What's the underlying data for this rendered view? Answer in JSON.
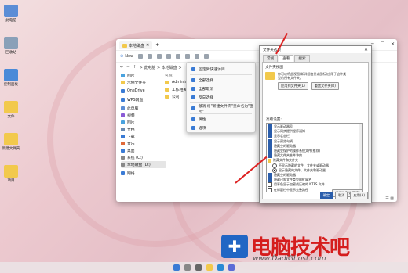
{
  "desktop": {
    "icons": [
      {
        "label": "此电脑",
        "color": "#5b8dd6"
      },
      {
        "label": "回收站",
        "color": "#8aa0b8"
      },
      {
        "label": "控制面板",
        "color": "#4a8ad8"
      },
      {
        "label": "文件",
        "color": "#f2c94c"
      },
      {
        "label": "新建文件夹",
        "color": "#f2c94c"
      },
      {
        "label": "项目",
        "color": "#f2c94c"
      }
    ]
  },
  "explorer": {
    "tab_label": "本地磁盘",
    "new_label": "New",
    "address": "> 此电脑 > 本地磁盘 >",
    "sidebar": [
      {
        "label": "图片",
        "icon": "pictures-icon",
        "color": "#4aa3df"
      },
      {
        "label": "示例文件夹",
        "icon": "folder-icon",
        "color": "#f2c94c"
      },
      {
        "label": "OneDrive",
        "icon": "cloud-icon",
        "color": "#3a7bd5"
      },
      {
        "label": "WPS网盘",
        "icon": "cloud-icon",
        "color": "#3a7bd5"
      },
      {
        "label": "此电脑",
        "icon": "computer-icon",
        "color": "#5b8dd6"
      },
      {
        "label": "视频",
        "icon": "video-icon",
        "color": "#8a5bd6"
      },
      {
        "label": "图片",
        "icon": "pictures-icon",
        "color": "#4aa3df"
      },
      {
        "label": "文档",
        "icon": "document-icon",
        "color": "#6a8ab0"
      },
      {
        "label": "下载",
        "icon": "download-icon",
        "color": "#3a7bd5"
      },
      {
        "label": "音乐",
        "icon": "music-icon",
        "color": "#e06a3a"
      },
      {
        "label": "桌面",
        "icon": "desktop-icon",
        "color": "#3a7bd5"
      },
      {
        "label": "系统 (C:)",
        "icon": "drive-icon",
        "color": "#888888"
      },
      {
        "label": "本地磁盘 (D:)",
        "icon": "drive-icon",
        "color": "#888888"
      },
      {
        "label": "网络",
        "icon": "network-icon",
        "color": "#3a7bd5"
      }
    ],
    "files_header": "名称",
    "files": [
      "Administrator",
      "工作相关",
      "公司"
    ]
  },
  "context_menu": {
    "items": [
      "固定到快速访问",
      "全部选择",
      "全部取消",
      "反向选择",
      "撤消 将\"新建文件夹\"重命名为\"图片\"",
      "属性",
      "选项"
    ]
  },
  "folder_options": {
    "title": "文件夹选项",
    "tabs": [
      "常规",
      "查看",
      "搜索"
    ],
    "folder_views_label": "文件夹视图",
    "folder_views_text": "你可以将此视图(如详细信息或图标)应用于这种类型的所有文件夹。",
    "apply_folders": "应用到文件夹(L)",
    "reset_folders": "重置文件夹(R)",
    "advanced_label": "高级设置:",
    "advanced": [
      {
        "kind": "cb",
        "on": true,
        "label": "显示驱动器号"
      },
      {
        "kind": "cb",
        "on": true,
        "label": "显示同步提供程序通知"
      },
      {
        "kind": "cb",
        "on": true,
        "label": "显示状态栏"
      },
      {
        "kind": "cb",
        "on": true,
        "label": "显示预览句柄"
      },
      {
        "kind": "cb",
        "on": true,
        "label": "隐藏空的驱动器"
      },
      {
        "kind": "cb",
        "on": true,
        "label": "隐藏受保护的操作系统文件(推荐)"
      },
      {
        "kind": "cb",
        "on": true,
        "label": "隐藏文件夹合并冲突"
      },
      {
        "kind": "grp",
        "on": false,
        "label": "隐藏文件和文件夹"
      },
      {
        "kind": "rd",
        "on": false,
        "label": "不显示隐藏的文件、文件夹或驱动器"
      },
      {
        "kind": "rd",
        "on": true,
        "label": "显示隐藏的文件、文件夹和驱动器"
      },
      {
        "kind": "cb",
        "on": true,
        "label": "隐藏空的驱动器"
      },
      {
        "kind": "cb",
        "on": true,
        "label": "隐藏已知文件类型的扩展名"
      },
      {
        "kind": "cb",
        "on": false,
        "label": "用彩色显示加密或压缩的 NTFS 文件"
      },
      {
        "kind": "cb",
        "on": false,
        "label": "在标题栏中显示完整路径"
      },
      {
        "kind": "cb",
        "on": false,
        "label": "在单独的进程中打开文件夹窗口"
      }
    ],
    "restore_defaults": "还原为默认值(D)",
    "ok": "确定",
    "cancel": "取消",
    "apply": "应用(A)"
  },
  "watermark": {
    "cn": "电脑技术吧",
    "en": "www.DadiGhost.com"
  }
}
